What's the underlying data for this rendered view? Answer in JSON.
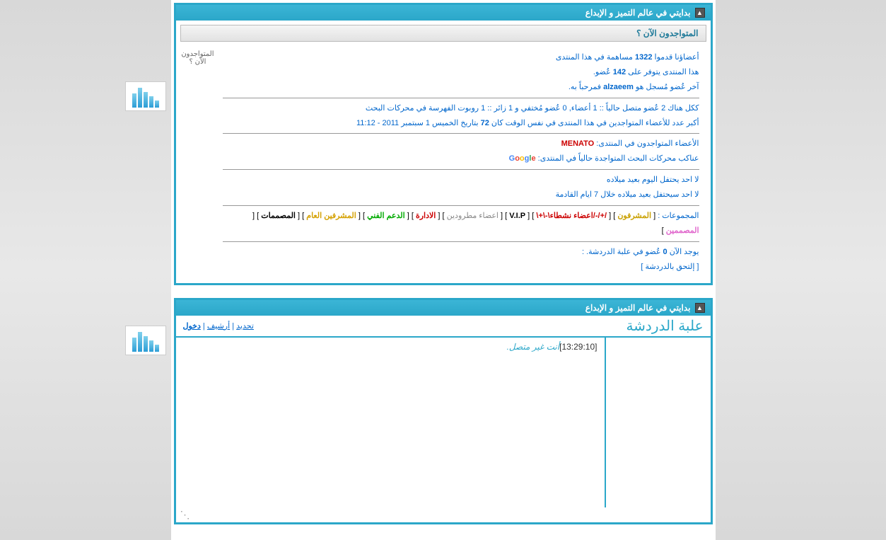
{
  "panel_title": "بدايتي في عالم التميز و الإبداع",
  "online_header": "المتواجدون الآن ؟",
  "side_label": "المتواجدون الآن ؟",
  "stats": {
    "line1_a": "أعضاؤنا قدموا ",
    "line1_b": "1322",
    "line1_c": " مساهمة في هذا المنتدى",
    "line2_a": "هذا المنتدى يتوفر على ",
    "line2_b": "142",
    "line2_c": " عُضو.",
    "line3_a": "آخر عُضو مُسجل هو ",
    "line3_user": "alzaeem",
    "line3_b": " فمرحباً به.",
    "line4": "ككل هناك 2 عُضو متصل حالياً :: 1 أعضاء, 0 عُضو مُختفي و 1 زائر :: 1 روبوت الفهرسة في محركات البحث",
    "line5_a": "أكبر عدد للأعضاء المتواجدين في هذا المنتدى في نفس الوقت كان ",
    "line5_b": "72",
    "line5_c": " بتاريخ الخميس 1 سبتمبر 2011 - 11:12",
    "online_label": "الأعضاء المتواجدون في المنتدى: ",
    "online_user": "MENATO",
    "bots_label": "عناكب محركات البحث المتواجدة حالياً في المنتدى: ",
    "bday1": "لا احد يحتفل اليوم بعيد ميلاده",
    "bday2": "لا احد سيحتفل بعيد ميلاده خلال 7 ايام القادمة",
    "groups_label": "المجموعات : ",
    "g_admin": "المشرفون",
    "g_active": "/+/-/اعضاء نشطاء\\-\\+\\",
    "g_vip": "V.I.P",
    "g_banned": "اعضاء مطرودين",
    "g_mgmt": "الادارة",
    "g_tech": "الدعم الفني",
    "g_gmod": "المشرفين العام",
    "g_designer": "المصممات",
    "g_designerf": "المصممين",
    "chat_count_a": "يوجد الآن ",
    "chat_count_b": "0",
    "chat_count_c": " عُضو في علبة الدردشة. :",
    "chat_join": "[ إلتحق بالدردشة ]"
  },
  "chatbox": {
    "title": "علبة الدردشة",
    "refresh": "تحديد",
    "archive": "أرشيف",
    "login": "دخول",
    "timestamp": "[13:29:10]",
    "message": "أنت غير متصل."
  }
}
